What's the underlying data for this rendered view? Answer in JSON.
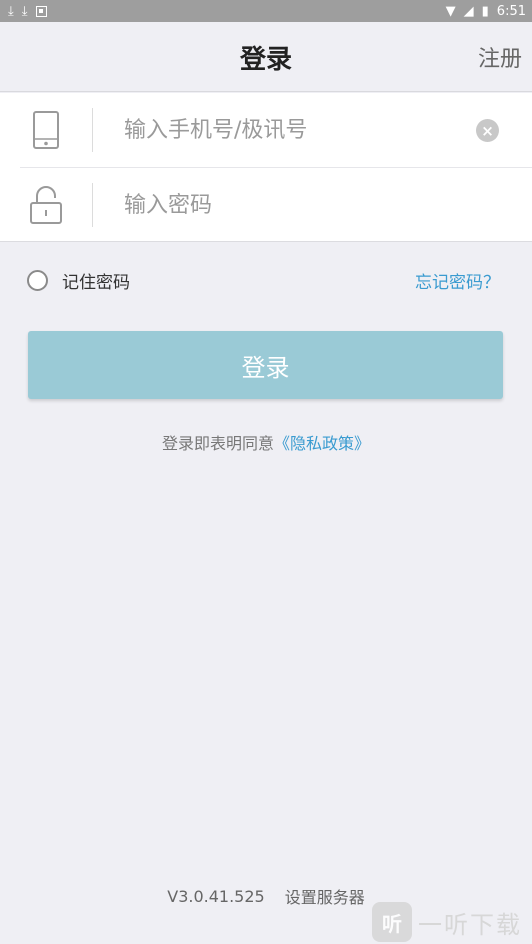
{
  "status_bar": {
    "left_icons": [
      "download-icon",
      "download-icon",
      "notification-icon"
    ],
    "time": "6:51"
  },
  "nav": {
    "title": "登录",
    "register_label": "注册"
  },
  "form": {
    "phone_placeholder": "输入手机号/极讯号",
    "password_placeholder": "输入密码"
  },
  "options": {
    "remember_label": "记住密码",
    "forgot_label": "忘记密码？"
  },
  "login_button_label": "登录",
  "agreement": {
    "prefix": "登录即表明同意",
    "policy_link": "《隐私政策》"
  },
  "footer": {
    "version": "V3.0.41.525",
    "server_link": "设置服务器"
  },
  "watermark": {
    "logo_char": "听",
    "text": "一听下载"
  },
  "colors": {
    "accent": "#3a9bd0",
    "button": "#9acad6",
    "background": "#efeff4"
  }
}
